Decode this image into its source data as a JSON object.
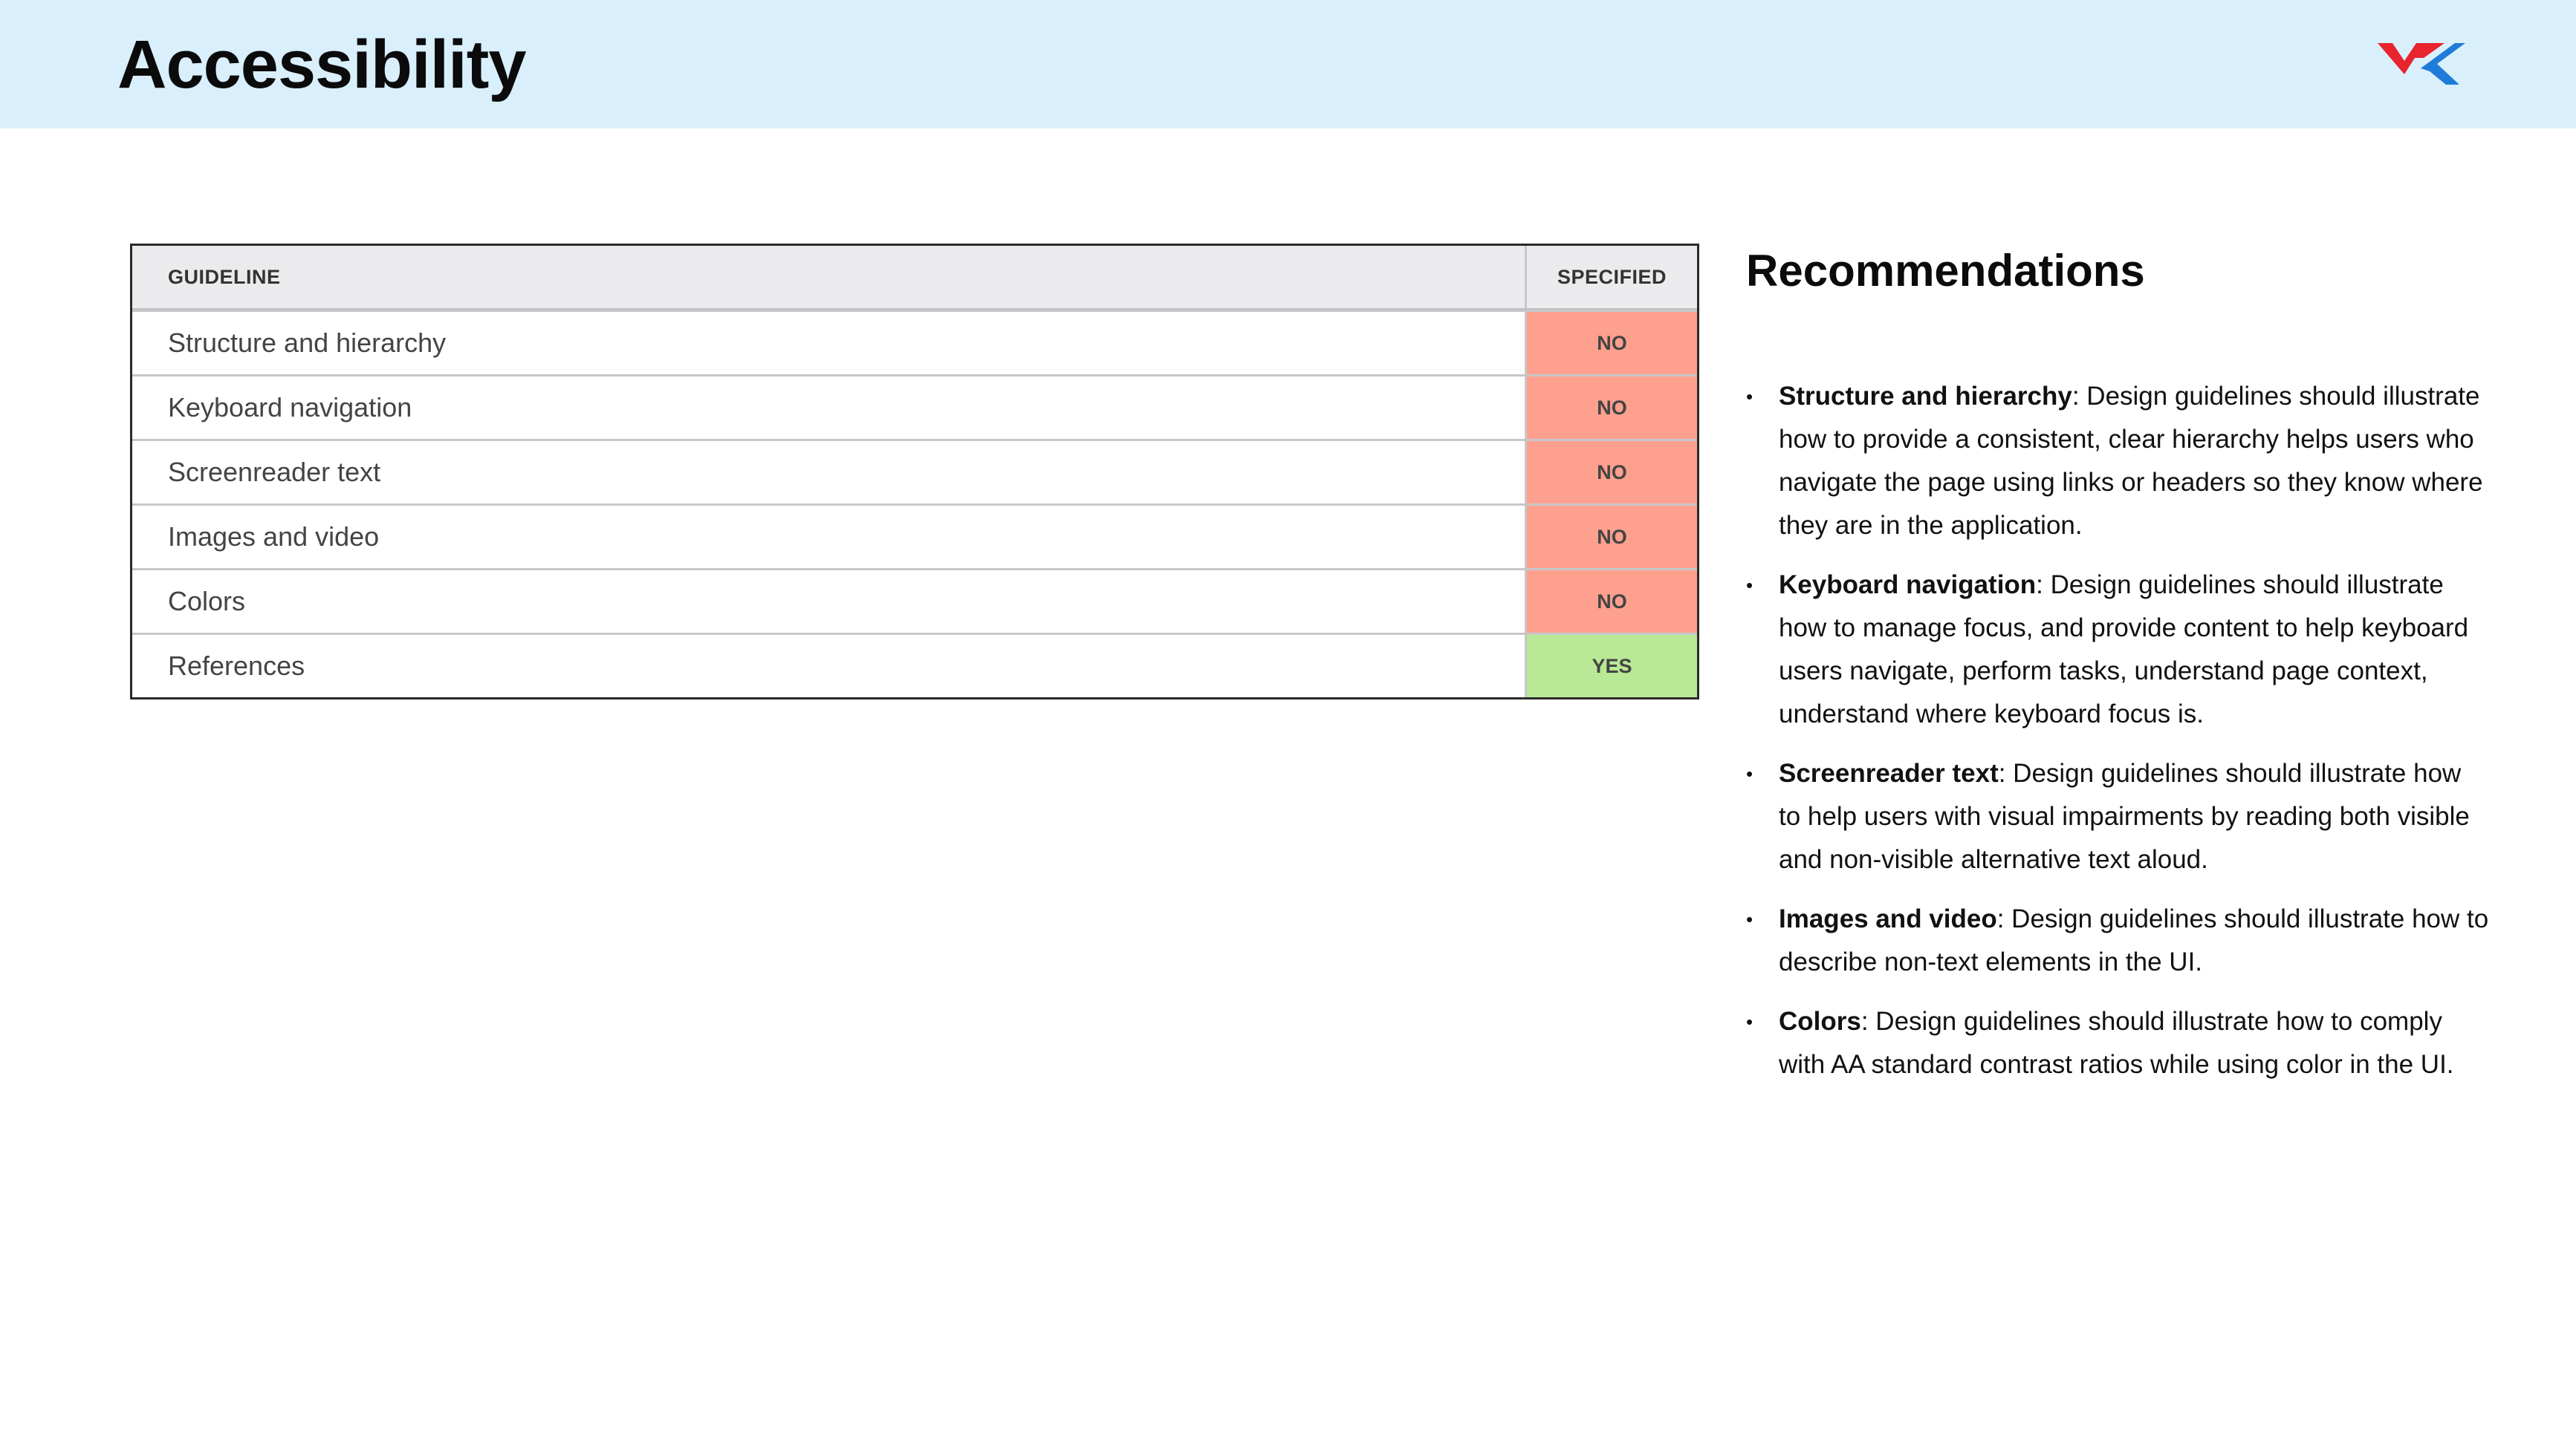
{
  "header": {
    "title": "Accessibility",
    "logo_colors": [
      "#e8242f",
      "#1f7bd8"
    ]
  },
  "table": {
    "columns": [
      "GUIDELINE",
      "SPECIFIED"
    ],
    "rows": [
      {
        "guideline": "Structure and hierarchy",
        "specified": "NO"
      },
      {
        "guideline": "Keyboard navigation",
        "specified": "NO"
      },
      {
        "guideline": "Screenreader text",
        "specified": "NO"
      },
      {
        "guideline": "Images and video",
        "specified": "NO"
      },
      {
        "guideline": "Colors",
        "specified": "NO"
      },
      {
        "guideline": "References",
        "specified": "YES"
      }
    ],
    "colors": {
      "no": "#fda08e",
      "yes": "#b9e896",
      "header": "#ebebed"
    }
  },
  "recommendations": {
    "title": "Recommendations",
    "items": [
      {
        "term": "Structure and hierarchy",
        "text": ": Design guidelines should illustrate how to provide a consistent, clear hierarchy helps users who navigate the page using links or headers so they know where they are in the application."
      },
      {
        "term": "Keyboard navigation",
        "text": ": Design guidelines should illustrate how to manage focus, and provide content to help keyboard users navigate, perform tasks, understand page context, understand where keyboard focus is."
      },
      {
        "term": "Screenreader text",
        "text": ": Design guidelines should illustrate how to help users with visual impairments by reading both visible and non-visible alternative text aloud."
      },
      {
        "term": "Images and video",
        "text": ": Design guidelines should illustrate how to describe non-text elements in the UI."
      },
      {
        "term": "Colors",
        "text": ": Design guidelines should illustrate how to comply with AA standard contrast ratios while using color in the UI."
      }
    ]
  }
}
